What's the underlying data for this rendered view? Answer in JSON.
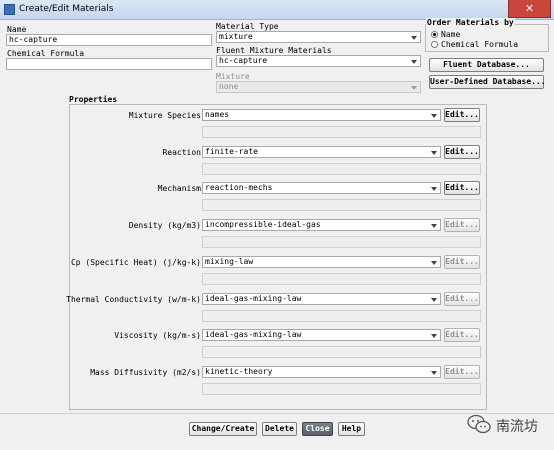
{
  "window": {
    "title": "Create/Edit Materials"
  },
  "name": {
    "label": "Name",
    "value": "hc-capture"
  },
  "chemical_formula": {
    "label": "Chemical Formula",
    "value": ""
  },
  "material_type": {
    "label": "Material Type",
    "value": "mixture"
  },
  "fluent_mixture": {
    "label": "Fluent Mixture Materials",
    "value": "hc-capture"
  },
  "mixture": {
    "label": "Mixture",
    "value": "none"
  },
  "order": {
    "label": "Order Materials by",
    "options": [
      {
        "label": "Name",
        "selected": true
      },
      {
        "label": "Chemical Formula",
        "selected": false
      }
    ]
  },
  "database_buttons": {
    "fluent": "Fluent Database...",
    "user": "User-Defined Database..."
  },
  "properties": {
    "label": "Properties",
    "rows": [
      {
        "label": "Mixture Species",
        "value": "names",
        "edit": "Edit...",
        "edit_enabled": true
      },
      {
        "label": "Reaction",
        "value": "finite-rate",
        "edit": "Edit...",
        "edit_enabled": true
      },
      {
        "label": "Mechanism",
        "value": "reaction-mechs",
        "edit": "Edit...",
        "edit_enabled": true
      },
      {
        "label": "Density (kg/m3)",
        "value": "incompressible-ideal-gas",
        "edit": "Edit...",
        "edit_enabled": false
      },
      {
        "label": "Cp (Specific Heat) (j/kg-k)",
        "value": "mixing-law",
        "edit": "Edit...",
        "edit_enabled": false
      },
      {
        "label": "Thermal Conductivity (w/m-k)",
        "value": "ideal-gas-mixing-law",
        "edit": "Edit...",
        "edit_enabled": false
      },
      {
        "label": "Viscosity (kg/m-s)",
        "value": "ideal-gas-mixing-law",
        "edit": "Edit...",
        "edit_enabled": false
      },
      {
        "label": "Mass Diffusivity (m2/s)",
        "value": "kinetic-theory",
        "edit": "Edit...",
        "edit_enabled": false
      }
    ]
  },
  "actions": {
    "change_create": "Change/Create",
    "delete": "Delete",
    "close": "Close",
    "help": "Help"
  },
  "watermark": {
    "text": "南流坊"
  }
}
